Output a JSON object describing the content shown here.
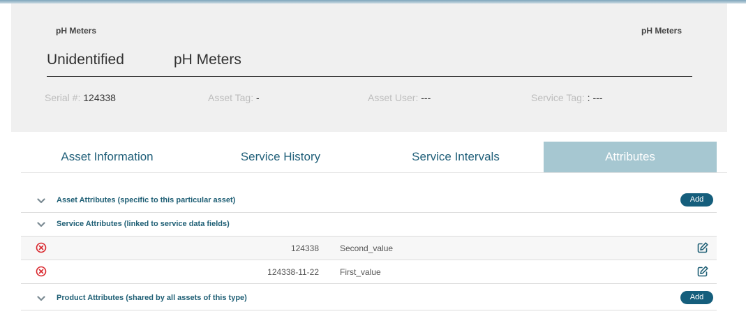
{
  "header": {
    "category_left": "pH Meters",
    "category_right": "pH Meters",
    "manufacturer": "Unidentified",
    "model": "pH Meters",
    "serial_label": "Serial #:",
    "serial_value": " 124338",
    "asset_tag_label": "Asset Tag:",
    "asset_tag_value": " -",
    "asset_user_label": "Asset User:",
    "asset_user_value": " ---",
    "service_tag_label": "Service Tag:",
    "service_tag_value": " : ---"
  },
  "tabs": [
    {
      "label": "Asset Information",
      "active": false
    },
    {
      "label": "Service History",
      "active": false
    },
    {
      "label": "Service Intervals",
      "active": false
    },
    {
      "label": "Attributes",
      "active": true
    }
  ],
  "sections": {
    "asset_attributes": {
      "title": "Asset Attributes (specific to this particular asset)",
      "add_label": "Add"
    },
    "service_attributes": {
      "title": "Service Attributes (linked to service data fields)",
      "rows": [
        {
          "value": "124338",
          "name": "Second_value"
        },
        {
          "value": "124338-11-22",
          "name": "First_value"
        }
      ]
    },
    "product_attributes": {
      "title": "Product Attributes (shared by all assets of this type)",
      "add_label": "Add"
    }
  },
  "colors": {
    "accent": "#155e7c",
    "tab_active_bg": "#a6c7d1",
    "tab_text": "#21607a",
    "remove_icon": "#d9262c",
    "edit_icon": "#1f5f75"
  },
  "icons": {
    "chevron": "chevron-down-icon",
    "remove": "remove-circle-icon",
    "edit": "edit-icon"
  }
}
